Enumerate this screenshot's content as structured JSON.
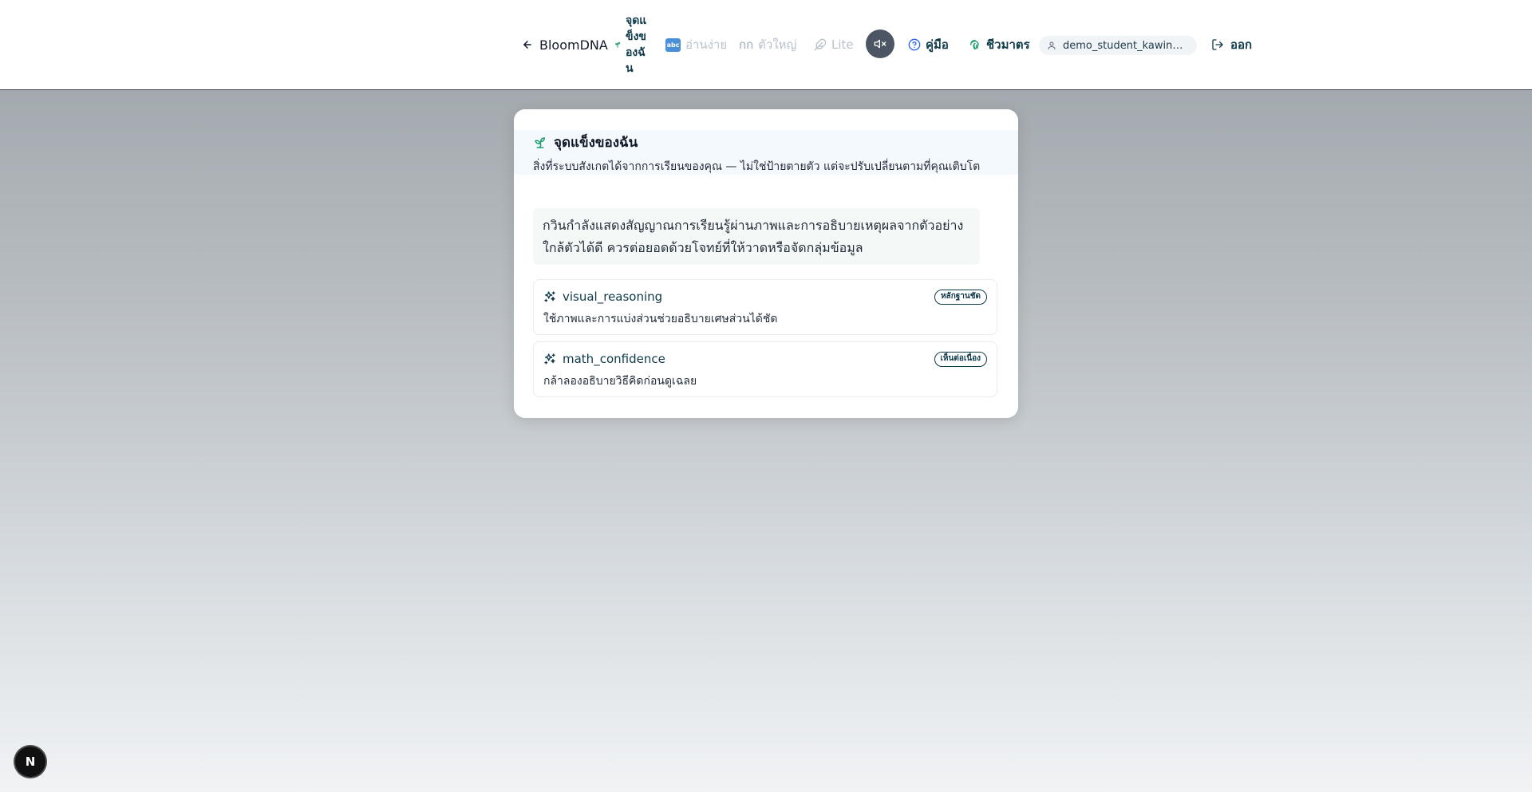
{
  "header": {
    "back_label": "BloomDNA",
    "my_strengths_label": "จุดแข็งของฉัน",
    "easy_read_icon_text": "abc",
    "easy_read_label": "อ่านง่าย",
    "big_text_prefix": "กก",
    "big_text_label": "ตัวใหญ่",
    "lite_label": "Lite",
    "guide_label": "คู่มือ",
    "biometric_label": "ชีวมาตร",
    "user_email": "demo_student_kawin@bl...",
    "logout_label": "ออก"
  },
  "modal": {
    "title": "จุดแข็งของฉัน",
    "subtitle": "สิ่งที่ระบบสังเกตได้จากการเรียนของคุณ — ไม่ใช่ป้ายตายตัว แต่จะปรับเปลี่ยนตามที่คุณเติบโต",
    "summary": "กวินกำลังแสดงสัญญาณการเรียนรู้ผ่านภาพและการอธิบายเหตุผลจากตัวอย่างใกล้ตัวได้ดี ควรต่อยอดด้วยโจทย์ที่ให้วาดหรือจัดกลุ่มข้อมูล",
    "strengths": [
      {
        "name": "visual_reasoning",
        "badge": "หลักฐานชัด",
        "description": "ใช้ภาพและการแบ่งส่วนช่วยอธิบายเศษส่วนได้ชัด"
      },
      {
        "name": "math_confidence",
        "badge": "เห็นต่อเนื่อง",
        "description": "กล้าลองอธิบายวิธีคิดก่อนดูเฉลย"
      }
    ]
  },
  "floating_button": {
    "label": "N"
  },
  "colors": {
    "accent_dark": "#0f3a4a",
    "accent_green": "#1f9d6b",
    "overlay_top": "#a3aaaf",
    "overlay_bottom": "#f1f3f5"
  },
  "icons": {
    "back": "arrow-left-icon",
    "strengths": "sprout-icon",
    "easy_read": "abc-icon",
    "lite": "feather-icon",
    "mute": "volume-mute-icon",
    "guide": "help-circle-icon",
    "biometric": "fingerprint-icon",
    "user": "user-icon",
    "logout": "log-out-icon",
    "strength_item": "sparkles-icon"
  }
}
